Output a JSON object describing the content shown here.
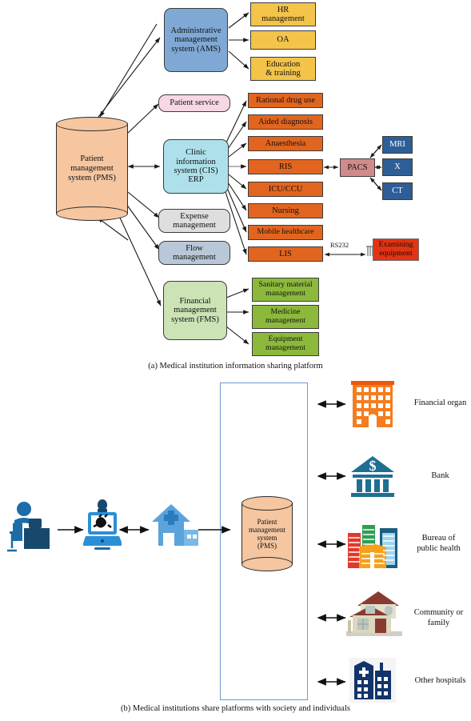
{
  "figure": {
    "panel_a": {
      "caption": "(a)  Medical institution information sharing platform",
      "hub": {
        "label": "Patient\nmanagement\nsystem (PMS)",
        "line1": "Patient",
        "line2": "management",
        "line3": "system (PMS)"
      },
      "subsystems": [
        {
          "id": "ams",
          "line1": "Administrative",
          "line2": "management",
          "line3": "system (AMS)",
          "color": "#7fa9d4"
        },
        {
          "id": "patient-service",
          "line1": "Patient service",
          "color": "#f7d7e4"
        },
        {
          "id": "cis",
          "line1": "Clinic",
          "line2": "information",
          "line3": "system (CIS)",
          "line4": "ERP",
          "color": "#ade0ea"
        },
        {
          "id": "expense",
          "line1": "Expense",
          "line2": "management",
          "color": "#dedede"
        },
        {
          "id": "flow",
          "line1": "Flow",
          "line2": "management",
          "color": "#b9c8d8"
        },
        {
          "id": "fms",
          "line1": "Financial",
          "line2": "management",
          "line3": "system (FMS)",
          "color": "#cce3b5"
        }
      ],
      "ams_children": [
        {
          "line1": "HR",
          "line2": "management"
        },
        {
          "line1": "OA"
        },
        {
          "line1": "Education",
          "line2": "& training"
        }
      ],
      "cis_children": [
        {
          "label": "Rational drug use"
        },
        {
          "label": "Aided diagnosis"
        },
        {
          "label": "Anaesthesia"
        },
        {
          "label": "RIS"
        },
        {
          "label": "ICU/CCU"
        },
        {
          "label": "Nursing"
        },
        {
          "label": "Mobile healthcare"
        },
        {
          "label": "LIS"
        }
      ],
      "fms_children": [
        {
          "line1": "Sanitary material",
          "line2": "management"
        },
        {
          "line1": "Medicine",
          "line2": "management"
        },
        {
          "line1": "Equipment",
          "line2": "management"
        }
      ],
      "pacs": {
        "label": "PACS"
      },
      "pacs_children": [
        {
          "label": "MRI"
        },
        {
          "label": "X"
        },
        {
          "label": "CT"
        }
      ],
      "lis_link": {
        "protocol": "RS232",
        "line1": "Examining",
        "line2": "equipment"
      }
    },
    "panel_b": {
      "caption": "(b)  Medical institutions share platforms with society and individuals",
      "flow_icons": [
        {
          "name": "person-at-desk-icon"
        },
        {
          "name": "laptop-telemedicine-icon"
        },
        {
          "name": "hospital-house-icon"
        }
      ],
      "hub": {
        "line1": "Patient",
        "line2": "management",
        "line3": "system",
        "line4": "(PMS)"
      },
      "partners": [
        {
          "label": "Financial organ",
          "icon": "office-building-icon",
          "color": "#f57c1f"
        },
        {
          "label": "Bank",
          "icon": "bank-icon",
          "color": "#1f6f93"
        },
        {
          "line1": "Bureau of",
          "line2": "public health",
          "icon": "city-buildings-icon",
          "color": "#e8a020"
        },
        {
          "line1": "Community or",
          "line2": "family",
          "icon": "house-villa-icon",
          "color": "#b9a98c"
        },
        {
          "label": "Other hospitals",
          "icon": "hospital-building-icon",
          "color": "#12346b"
        }
      ]
    }
  }
}
